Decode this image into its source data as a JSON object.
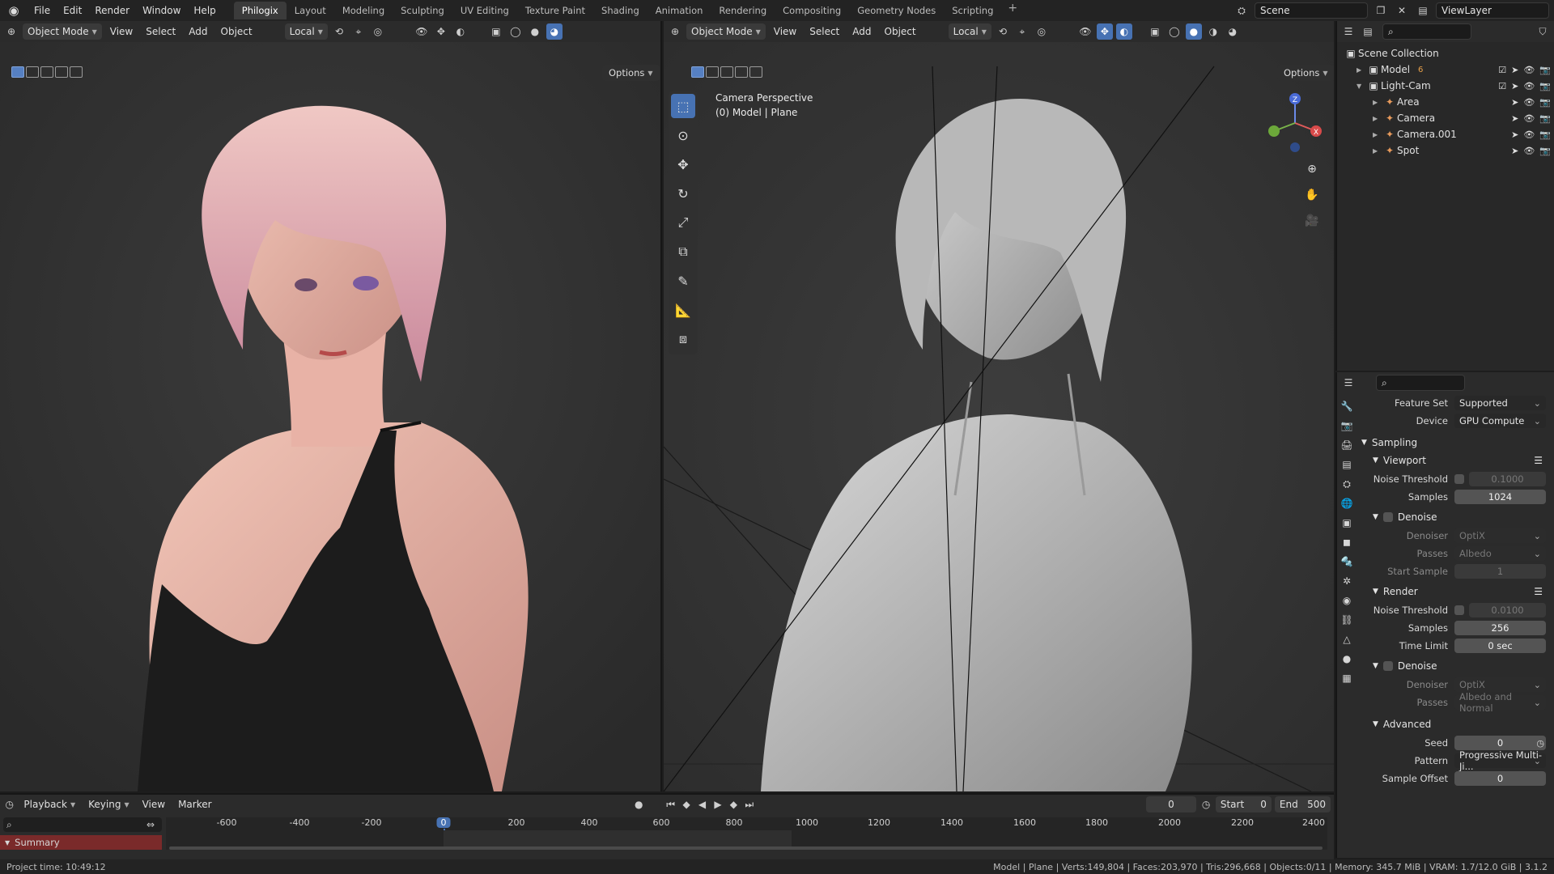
{
  "app": {
    "menu": [
      "File",
      "Edit",
      "Render",
      "Window",
      "Help"
    ]
  },
  "workspaces": {
    "tabs": [
      "Philogix",
      "Layout",
      "Modeling",
      "Sculpting",
      "UV Editing",
      "Texture Paint",
      "Shading",
      "Animation",
      "Rendering",
      "Compositing",
      "Geometry Nodes",
      "Scripting"
    ],
    "active": "Philogix",
    "add": "+"
  },
  "scene": {
    "name": "Scene",
    "view_layer": "ViewLayer"
  },
  "left_viewport": {
    "mode": "Object Mode",
    "menus": [
      "View",
      "Select",
      "Add",
      "Object"
    ],
    "transform": "Local",
    "options": "Options"
  },
  "right_viewport": {
    "mode": "Object Mode",
    "menus": [
      "View",
      "Select",
      "Add",
      "Object"
    ],
    "transform": "Local",
    "options": "Options",
    "overlay_title": "Camera Perspective",
    "overlay_subtitle": "(0) Model | Plane"
  },
  "gizmo": {
    "x": "X",
    "y": "Y",
    "z": "Z"
  },
  "outliner": {
    "root": "Scene Collection",
    "items": [
      {
        "label": "Model",
        "badge": "6",
        "level": 0,
        "expanded": false
      },
      {
        "label": "Light-Cam",
        "level": 0,
        "expanded": true
      },
      {
        "label": "Area",
        "level": 1
      },
      {
        "label": "Camera",
        "level": 1
      },
      {
        "label": "Camera.001",
        "level": 1
      },
      {
        "label": "Spot",
        "level": 1
      }
    ]
  },
  "properties": {
    "feature_set_label": "Feature Set",
    "feature_set": "Supported",
    "device_label": "Device",
    "device": "GPU Compute",
    "sampling": "Sampling",
    "viewport": "Viewport",
    "vp_noise_label": "Noise Threshold",
    "vp_noise": "0.1000",
    "vp_samples_label": "Samples",
    "vp_samples": "1024",
    "vp_denoise": "Denoise",
    "vp_denoiser_label": "Denoiser",
    "vp_denoiser": "OptiX",
    "vp_passes_label": "Passes",
    "vp_passes": "Albedo",
    "vp_start_label": "Start Sample",
    "vp_start": "1",
    "render": "Render",
    "r_noise_label": "Noise Threshold",
    "r_noise": "0.0100",
    "r_samples_label": "Samples",
    "r_samples": "256",
    "r_time_label": "Time Limit",
    "r_time": "0 sec",
    "r_denoise": "Denoise",
    "r_denoiser_label": "Denoiser",
    "r_denoiser": "OptiX",
    "r_passes_label": "Passes",
    "r_passes": "Albedo and Normal",
    "advanced": "Advanced",
    "seed_label": "Seed",
    "seed": "0",
    "pattern_label": "Pattern",
    "pattern": "Progressive Multi-Ji...",
    "offset_label": "Sample Offset",
    "offset": "0"
  },
  "timeline": {
    "menus": [
      "Playback",
      "Keying",
      "View",
      "Marker"
    ],
    "current_frame": "0",
    "start_label": "Start",
    "start": "0",
    "end_label": "End",
    "end": "500",
    "ticks": [
      "-600",
      "-400",
      "-200",
      "0",
      "200",
      "400",
      "600",
      "800",
      "1000",
      "1200",
      "1400",
      "1600",
      "1800",
      "2000",
      "2200",
      "2400"
    ],
    "summary": "Summary"
  },
  "status": {
    "left": "Project time: 10:49:12",
    "right": "Model | Plane | Verts:149,804 | Faces:203,970 | Tris:296,668 | Objects:0/11 | Memory: 345.7 MiB | VRAM: 1.7/12.0 GiB | 3.1.2"
  },
  "colors": {
    "accent": "#4772b3",
    "header": "#2b2b2b",
    "viewport": "#3a3a3a",
    "summary": "#7a2a2a"
  }
}
